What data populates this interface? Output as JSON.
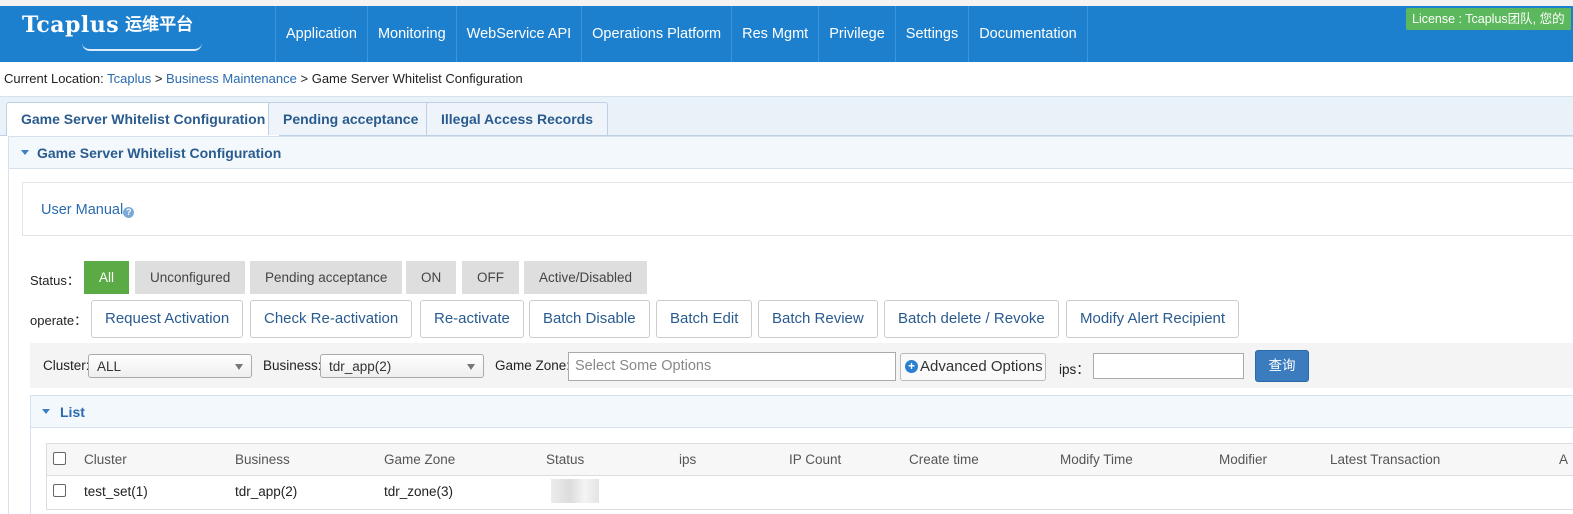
{
  "logo": {
    "main": "Tcaplus",
    "sub": "运维平台"
  },
  "nav": [
    "Application",
    "Monitoring",
    "WebService API",
    "Operations Platform",
    "Res Mgmt",
    "Privilege",
    "Settings",
    "Documentation"
  ],
  "license": "License : Tcaplus团队, 您的",
  "breadcrumb": {
    "prefix": "Current Location:",
    "home": "Tcaplus",
    "sep1": ">",
    "section": "Business Maintenance",
    "sep2": ">",
    "current": "Game Server Whitelist Configuration"
  },
  "tabs": [
    "Game Server Whitelist Configuration",
    "Pending acceptance",
    "Illegal Access Records"
  ],
  "panel_title": "Game Server Whitelist Configuration",
  "user_manual": "User Manual",
  "status": {
    "label": "Status：",
    "options": [
      "All",
      "Unconfigured",
      "Pending acceptance",
      "ON",
      "OFF",
      "Active/Disabled"
    ],
    "selected": "All"
  },
  "operate": {
    "label": "operate：",
    "buttons": [
      "Request Activation",
      "Check Re-activation",
      "Re-activate",
      "Batch Disable",
      "Batch Edit",
      "Batch Review",
      "Batch delete / Revoke",
      "Modify Alert Recipient"
    ]
  },
  "filters": {
    "cluster_label": "Cluster:",
    "cluster_value": "ALL",
    "business_label": "Business:",
    "business_value": "tdr_app(2)",
    "zone_label": "Game Zone:",
    "zone_placeholder": "Select Some Options",
    "advanced_label": "Advanced Options",
    "ips_label": "ips：",
    "ips_value": "",
    "query_label": "查询"
  },
  "list": {
    "title": "List",
    "columns": [
      "Cluster",
      "Business",
      "Game Zone",
      "Status",
      "ips",
      "IP Count",
      "Create time",
      "Modify Time",
      "Modifier",
      "Latest Transaction",
      "A"
    ],
    "rows": [
      {
        "cluster": "test_set(1)",
        "business": "tdr_app(2)",
        "zone": "tdr_zone(3)"
      }
    ]
  },
  "colors": {
    "header_blue": "#1d80cf",
    "active_green": "#5aaa46",
    "license_green": "#5cb85c",
    "link_blue": "#2a6bb0",
    "query_blue": "#3a7cbd"
  },
  "icons": [
    "help-icon",
    "add-circle-icon",
    "chevron-down-icon",
    "collapse-triangle-icon"
  ]
}
